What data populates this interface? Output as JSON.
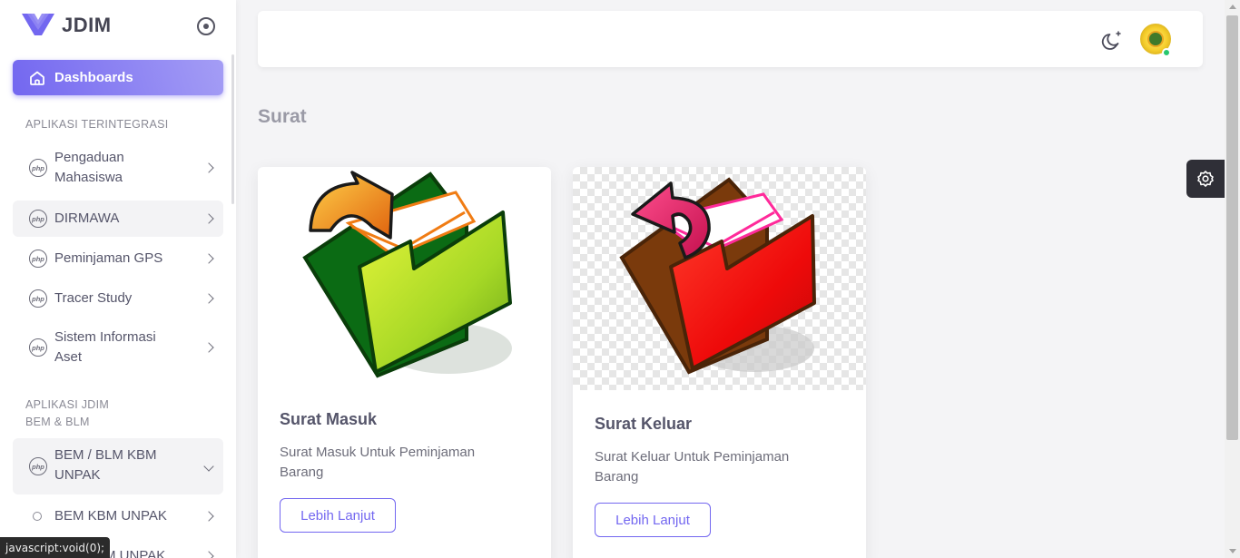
{
  "brand": {
    "name": "JDIM"
  },
  "sidebar": {
    "active_item": {
      "label": "Dashboards",
      "icon": "home-icon"
    },
    "sections": [
      {
        "label": "APLIKASI TERINTEGRASI"
      },
      {
        "label_line1": "APLIKASI JDIM",
        "label_line2": "BEM & BLM"
      }
    ],
    "items": [
      {
        "label_line1": "Pengaduan",
        "label_line2": "Mahasiswa",
        "icon": "php-icon"
      },
      {
        "label": "DIRMAWA",
        "icon": "php-icon"
      },
      {
        "label": "Peminjaman GPS",
        "icon": "php-icon"
      },
      {
        "label": "Tracer Study",
        "icon": "php-icon"
      },
      {
        "label_line1": "Sistem Informasi",
        "label_line2": "Aset",
        "icon": "php-icon"
      },
      {
        "label_line1": "BEM / BLM KBM",
        "label_line2": "UNPAK",
        "icon": "php-icon"
      },
      {
        "label": "BEM KBM UNPAK",
        "icon": "circle-icon"
      },
      {
        "label": "BLM KBM UNPAK",
        "icon": "circle-icon"
      }
    ],
    "php_glyph": "php"
  },
  "header": {
    "theme_icon": "moon-icon",
    "avatar_status": "online"
  },
  "page": {
    "title": "Surat"
  },
  "cards": [
    {
      "title": "Surat Masuk",
      "desc": "Surat Masuk Untuk Peminjaman Barang",
      "button": "Lebih Lanjut",
      "image": "inbox-folder-illustration"
    },
    {
      "title": "Surat Keluar",
      "desc": "Surat Keluar Untuk Peminjaman Barang",
      "button": "Lebih Lanjut",
      "image": "outbox-folder-illustration"
    }
  ],
  "status_bar": {
    "text": "javascript:void(0);"
  },
  "colors": {
    "primary": "#7367f0",
    "online": "#28c76f"
  }
}
